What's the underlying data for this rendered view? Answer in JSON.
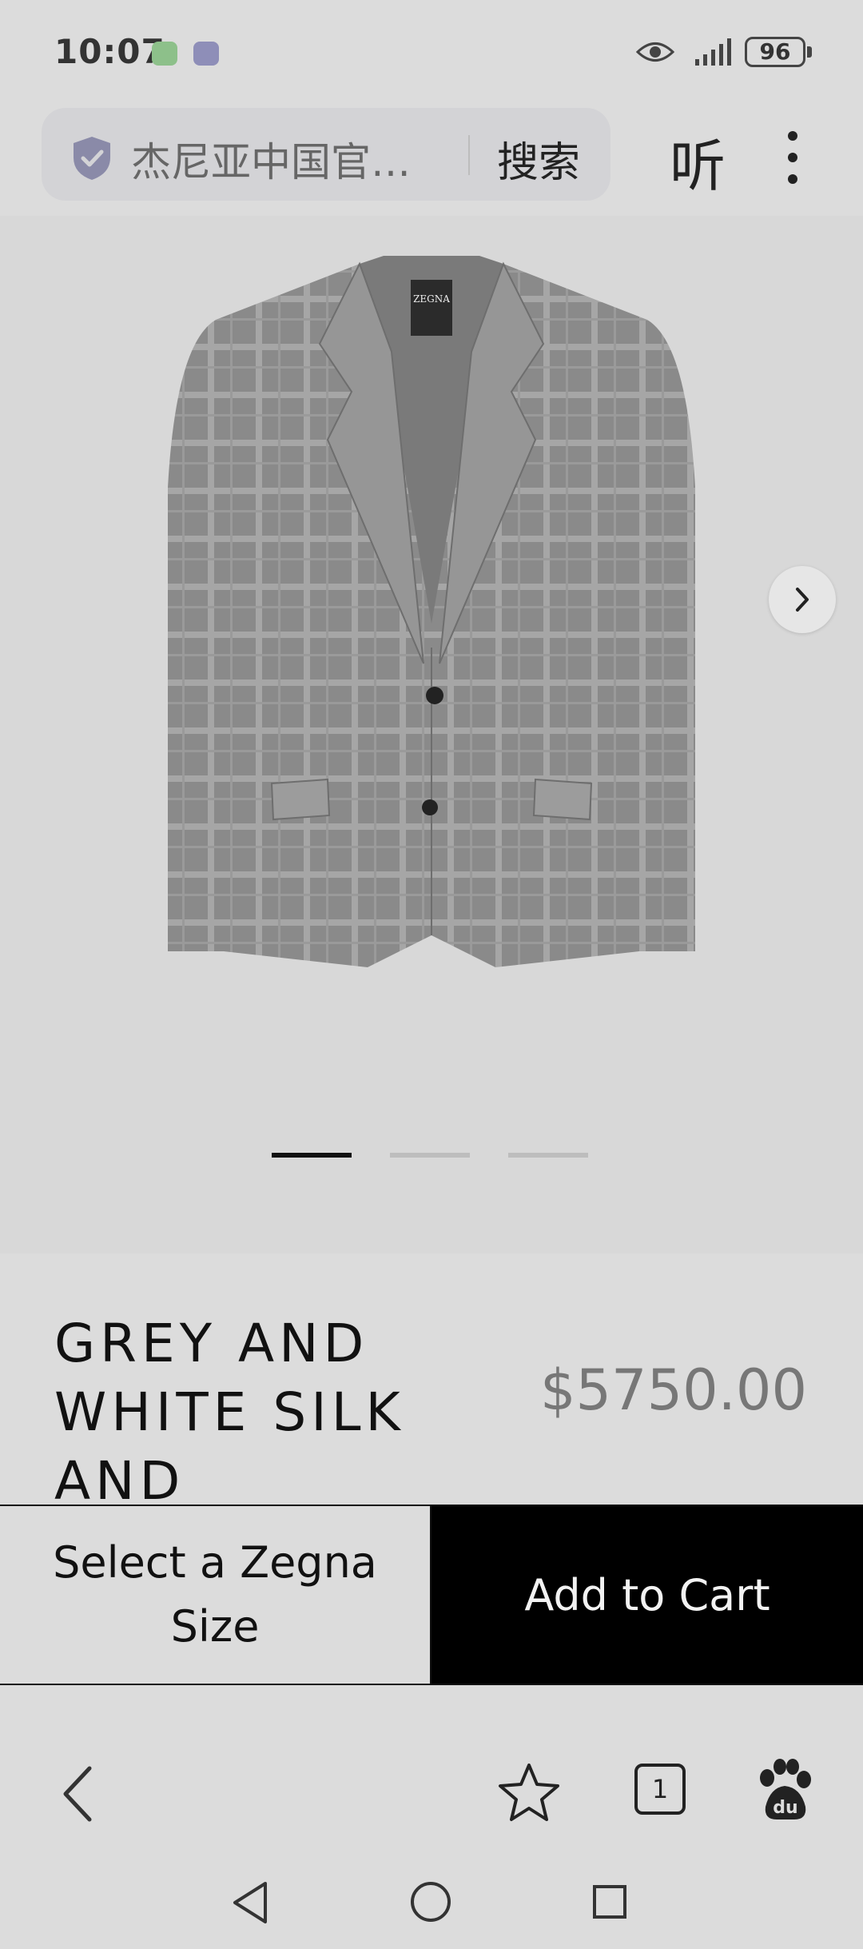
{
  "status_bar": {
    "time": "10:07",
    "battery": "96",
    "icons": [
      "wechat-icon",
      "app-icon",
      "eye-icon",
      "signal-icon",
      "battery-icon"
    ]
  },
  "browser": {
    "address_text": "杰尼亚中国官…",
    "search_label": "搜索",
    "listen_label": "听"
  },
  "product": {
    "title": "GREY AND WHITE SILK AND",
    "price": "$5750.00",
    "image_count": 3,
    "active_image": 1
  },
  "actions": {
    "size_label": "Select a Zegna Size",
    "cart_label": "Add to Cart"
  },
  "bottom_bar": {
    "tab_count": "1"
  },
  "colors": {
    "background": "#dcdcdc",
    "cart_button": "#000000",
    "price_text": "#777777"
  }
}
